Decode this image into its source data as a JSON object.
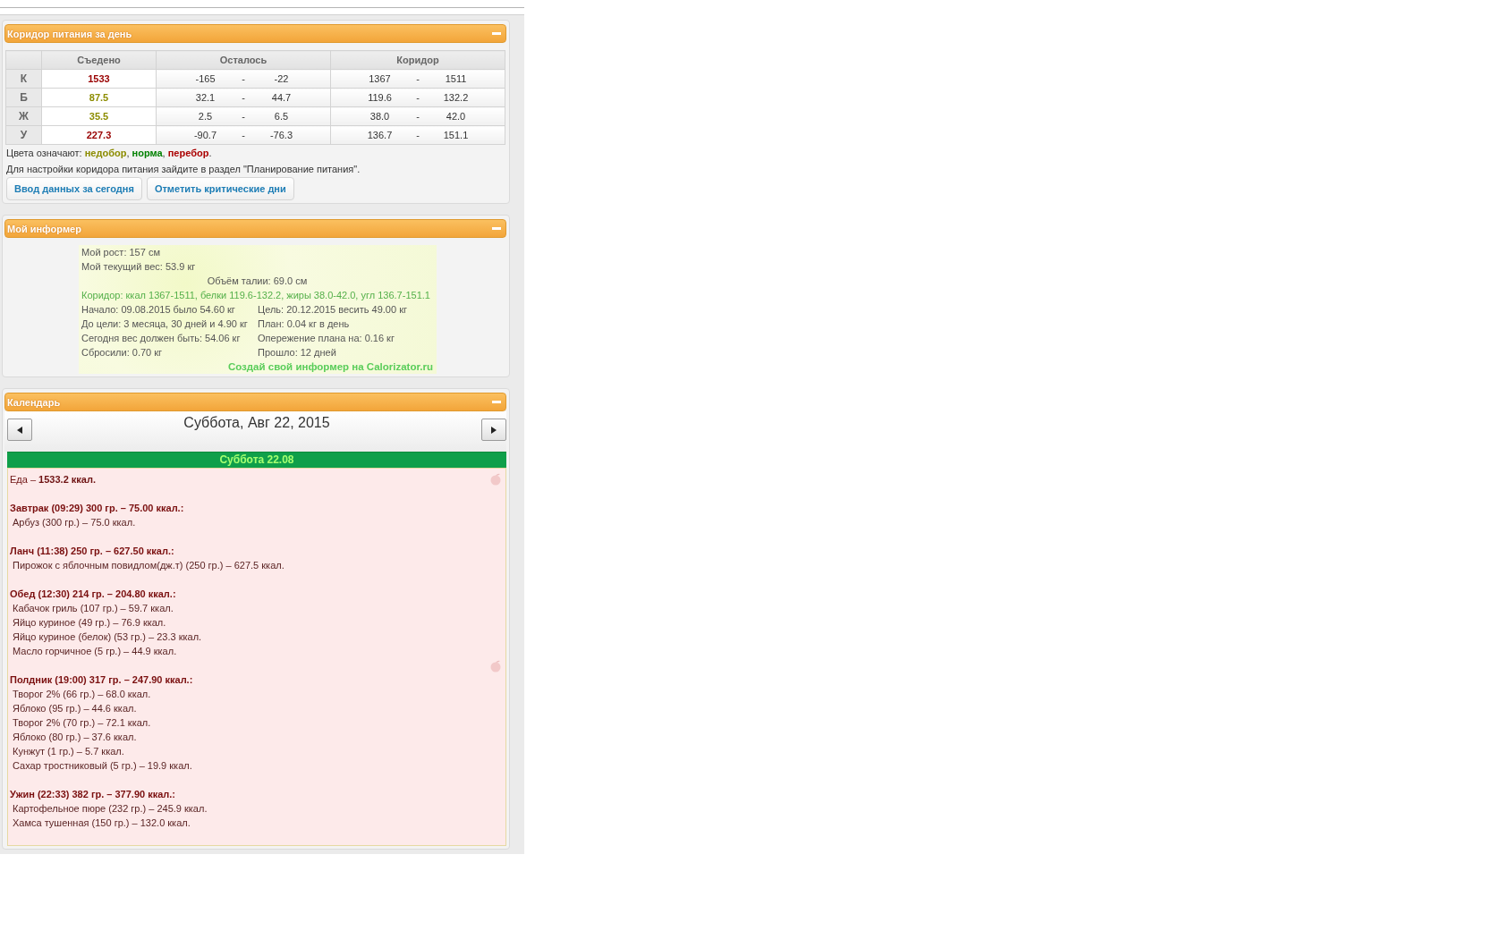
{
  "corridor_panel": {
    "title": "Коридор питания за день",
    "expanded": true,
    "table": {
      "columns": [
        "Съедено",
        "Осталось",
        "Коридор"
      ],
      "rows": [
        {
          "label": "К",
          "eaten": "1533",
          "color": "#990000",
          "remaining": [
            "-165",
            "-",
            "-22"
          ],
          "corridor": [
            "1367",
            "-",
            "1511"
          ]
        },
        {
          "label": "Б",
          "eaten": "87.5",
          "color": "#8c8c00",
          "remaining": [
            "32.1",
            "-",
            "44.7"
          ],
          "corridor": [
            "119.6",
            "-",
            "132.2"
          ]
        },
        {
          "label": "Ж",
          "eaten": "35.5",
          "color": "#8c8c00",
          "remaining": [
            "2.5",
            "-",
            "6.5"
          ],
          "corridor": [
            "38.0",
            "-",
            "42.0"
          ]
        },
        {
          "label": "У",
          "eaten": "227.3",
          "color": "#990000",
          "remaining": [
            "-90.7",
            "-",
            "-76.3"
          ],
          "corridor": [
            "136.7",
            "-",
            "151.1"
          ]
        }
      ]
    },
    "legend": {
      "label": "Цвета означают:",
      "items": [
        {
          "text": "недобор",
          "color": "#8c8c00"
        },
        {
          "text": "норма",
          "color": "#008000"
        },
        {
          "text": "перебор",
          "color": "#aa0000"
        }
      ],
      "separator": ",",
      "end": "."
    },
    "hint": "Для настройки коридора питания зайдите в раздел \"Планирование питания\".",
    "buttons": [
      "Ввод данных за сегодня",
      "Отметить критические дни"
    ]
  },
  "informer_panel": {
    "title": "Мой информер",
    "expanded": true,
    "rows": [
      {
        "kind": "single",
        "text": "Мой рост: 157 см"
      },
      {
        "kind": "single",
        "text": "Мой текущий вес: 53.9 кг"
      },
      {
        "kind": "center",
        "text": "Объём талии: 69.0 см"
      },
      {
        "kind": "highlight",
        "text": "Коридор: ккал 1367-1511, белки 119.6-132.2, жиры 38.0-42.0, угл 136.7-151.1"
      },
      {
        "kind": "pair",
        "texts": [
          "Начало: 09.08.2015 было 54.60 кг",
          "Цель: 20.12.2015 весить 49.00 кг"
        ]
      },
      {
        "kind": "pair",
        "texts": [
          "До цели: 3 месяца, 30 дней и 4.90 кг",
          "План: 0.04 кг в день"
        ]
      },
      {
        "kind": "pair",
        "texts": [
          "Сегодня вес должен быть: 54.06 кг",
          "Опережение плана на: 0.16 кг"
        ]
      },
      {
        "kind": "pair",
        "texts": [
          "Сбросили: 0.70 кг",
          "Прошло: 12 дней"
        ]
      },
      {
        "kind": "link",
        "text": "Создай свой информер на Calorizator.ru"
      }
    ]
  },
  "calendar_panel": {
    "title": "Календарь",
    "expanded": true,
    "date": "Суббота, Авг 22, 2015",
    "day": {
      "title": "Суббота 22.08",
      "total": "Еда – **1533.2 ккал.**",
      "meals": [
        {
          "title": "Завтрак (09:29) 300 гр. – 75.00 ккал.:",
          "items": [
            "Арбуз (300 гр.) – 75.0 ккал."
          ]
        },
        {
          "title": "Ланч (11:38) 250 гр. – 627.50 ккал.:",
          "items": [
            "Пирожок с яблочным повидлом(дж.т) (250 гр.) – 627.5 ккал."
          ]
        },
        {
          "title": "Обед (12:30) 214 гр. – 204.80 ккал.:",
          "items": [
            "Кабачок гриль (107 гр.) – 59.7 ккал.",
            "Яйцо куриное (49 гр.) – 76.9 ккал.",
            "Яйцо куриное (белок) (53 гр.) – 23.3 ккал.",
            "Масло горчичное (5 гр.) – 44.9 ккал."
          ]
        },
        {
          "title": "Полдник (19:00) 317 гр. – 247.90 ккал.:",
          "items": [
            "Творог 2% (66 гр.) – 68.0 ккал.",
            "Яблоко (95 гр.) – 44.6 ккал.",
            "Творог 2% (70 гр.) – 72.1 ккал.",
            "Яблоко (80 гр.) – 37.6 ккал.",
            "Кунжут (1 гр.) – 5.7 ккал.",
            "Сахар тростниковый (5 гр.) – 19.9 ккал."
          ]
        },
        {
          "title": "Ужин (22:33) 382 гр. – 377.90 ккал.:",
          "items": [
            "Картофельное пюре (232 гр.) – 245.9 ккал.",
            "Хамса тушенная (150 гр.) – 132.0 ккал."
          ]
        }
      ]
    }
  }
}
